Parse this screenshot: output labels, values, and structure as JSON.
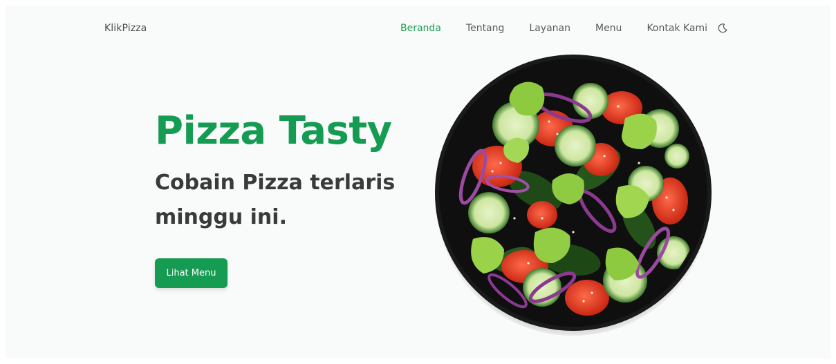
{
  "header": {
    "logo": "KlikPizza",
    "nav": [
      {
        "label": "Beranda",
        "active": true
      },
      {
        "label": "Tentang",
        "active": false
      },
      {
        "label": "Layanan",
        "active": false
      },
      {
        "label": "Menu",
        "active": false
      },
      {
        "label": "Kontak Kami",
        "active": false
      }
    ],
    "theme_toggle_icon": "moon-icon"
  },
  "hero": {
    "title": "Pizza Tasty",
    "subtitle": "Cobain Pizza terlaris minggu ini.",
    "cta_label": "Lihat Menu",
    "image": "salad-plate-image"
  },
  "colors": {
    "accent": "#169b52",
    "background": "#f8fbfa",
    "text": "#3a3a3a"
  }
}
